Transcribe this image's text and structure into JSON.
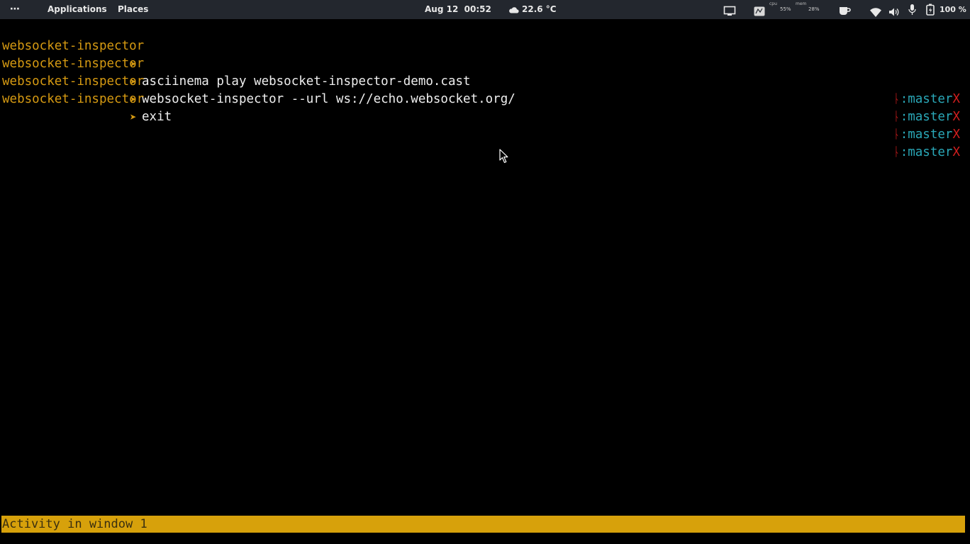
{
  "topbar": {
    "menu_dots": "⋯",
    "applications": "Applications",
    "places": "Places",
    "date": "Aug 12",
    "time": "00:52",
    "weather_temp": "22.6 °C",
    "cpu_label": "cpu",
    "cpu_value": "55%",
    "mem_label": "mem",
    "mem_value": "28%",
    "battery_value": "100 %"
  },
  "terminal": {
    "prompt_dir": "websocket-inspector",
    "prompt_symbol": "➤",
    "git_branch_symbol": "ᚿ",
    "git_branch": ":master",
    "git_dirty": "X",
    "lines": [
      {
        "command": "asciinema play websocket-inspector-demo.cast"
      },
      {
        "command": "websocket-inspector --url ws://echo.websocket.org/"
      },
      {
        "command": "exit"
      },
      {
        "command": ""
      }
    ]
  },
  "statusbar": {
    "text": "Activity in window 1"
  },
  "colors": {
    "background": "#000000",
    "topbar": "#23272e",
    "prompt": "#d69a12",
    "branch": "#2aa8b8",
    "git_marker": "#d21e1e",
    "statusbar": "#d7a10b"
  }
}
